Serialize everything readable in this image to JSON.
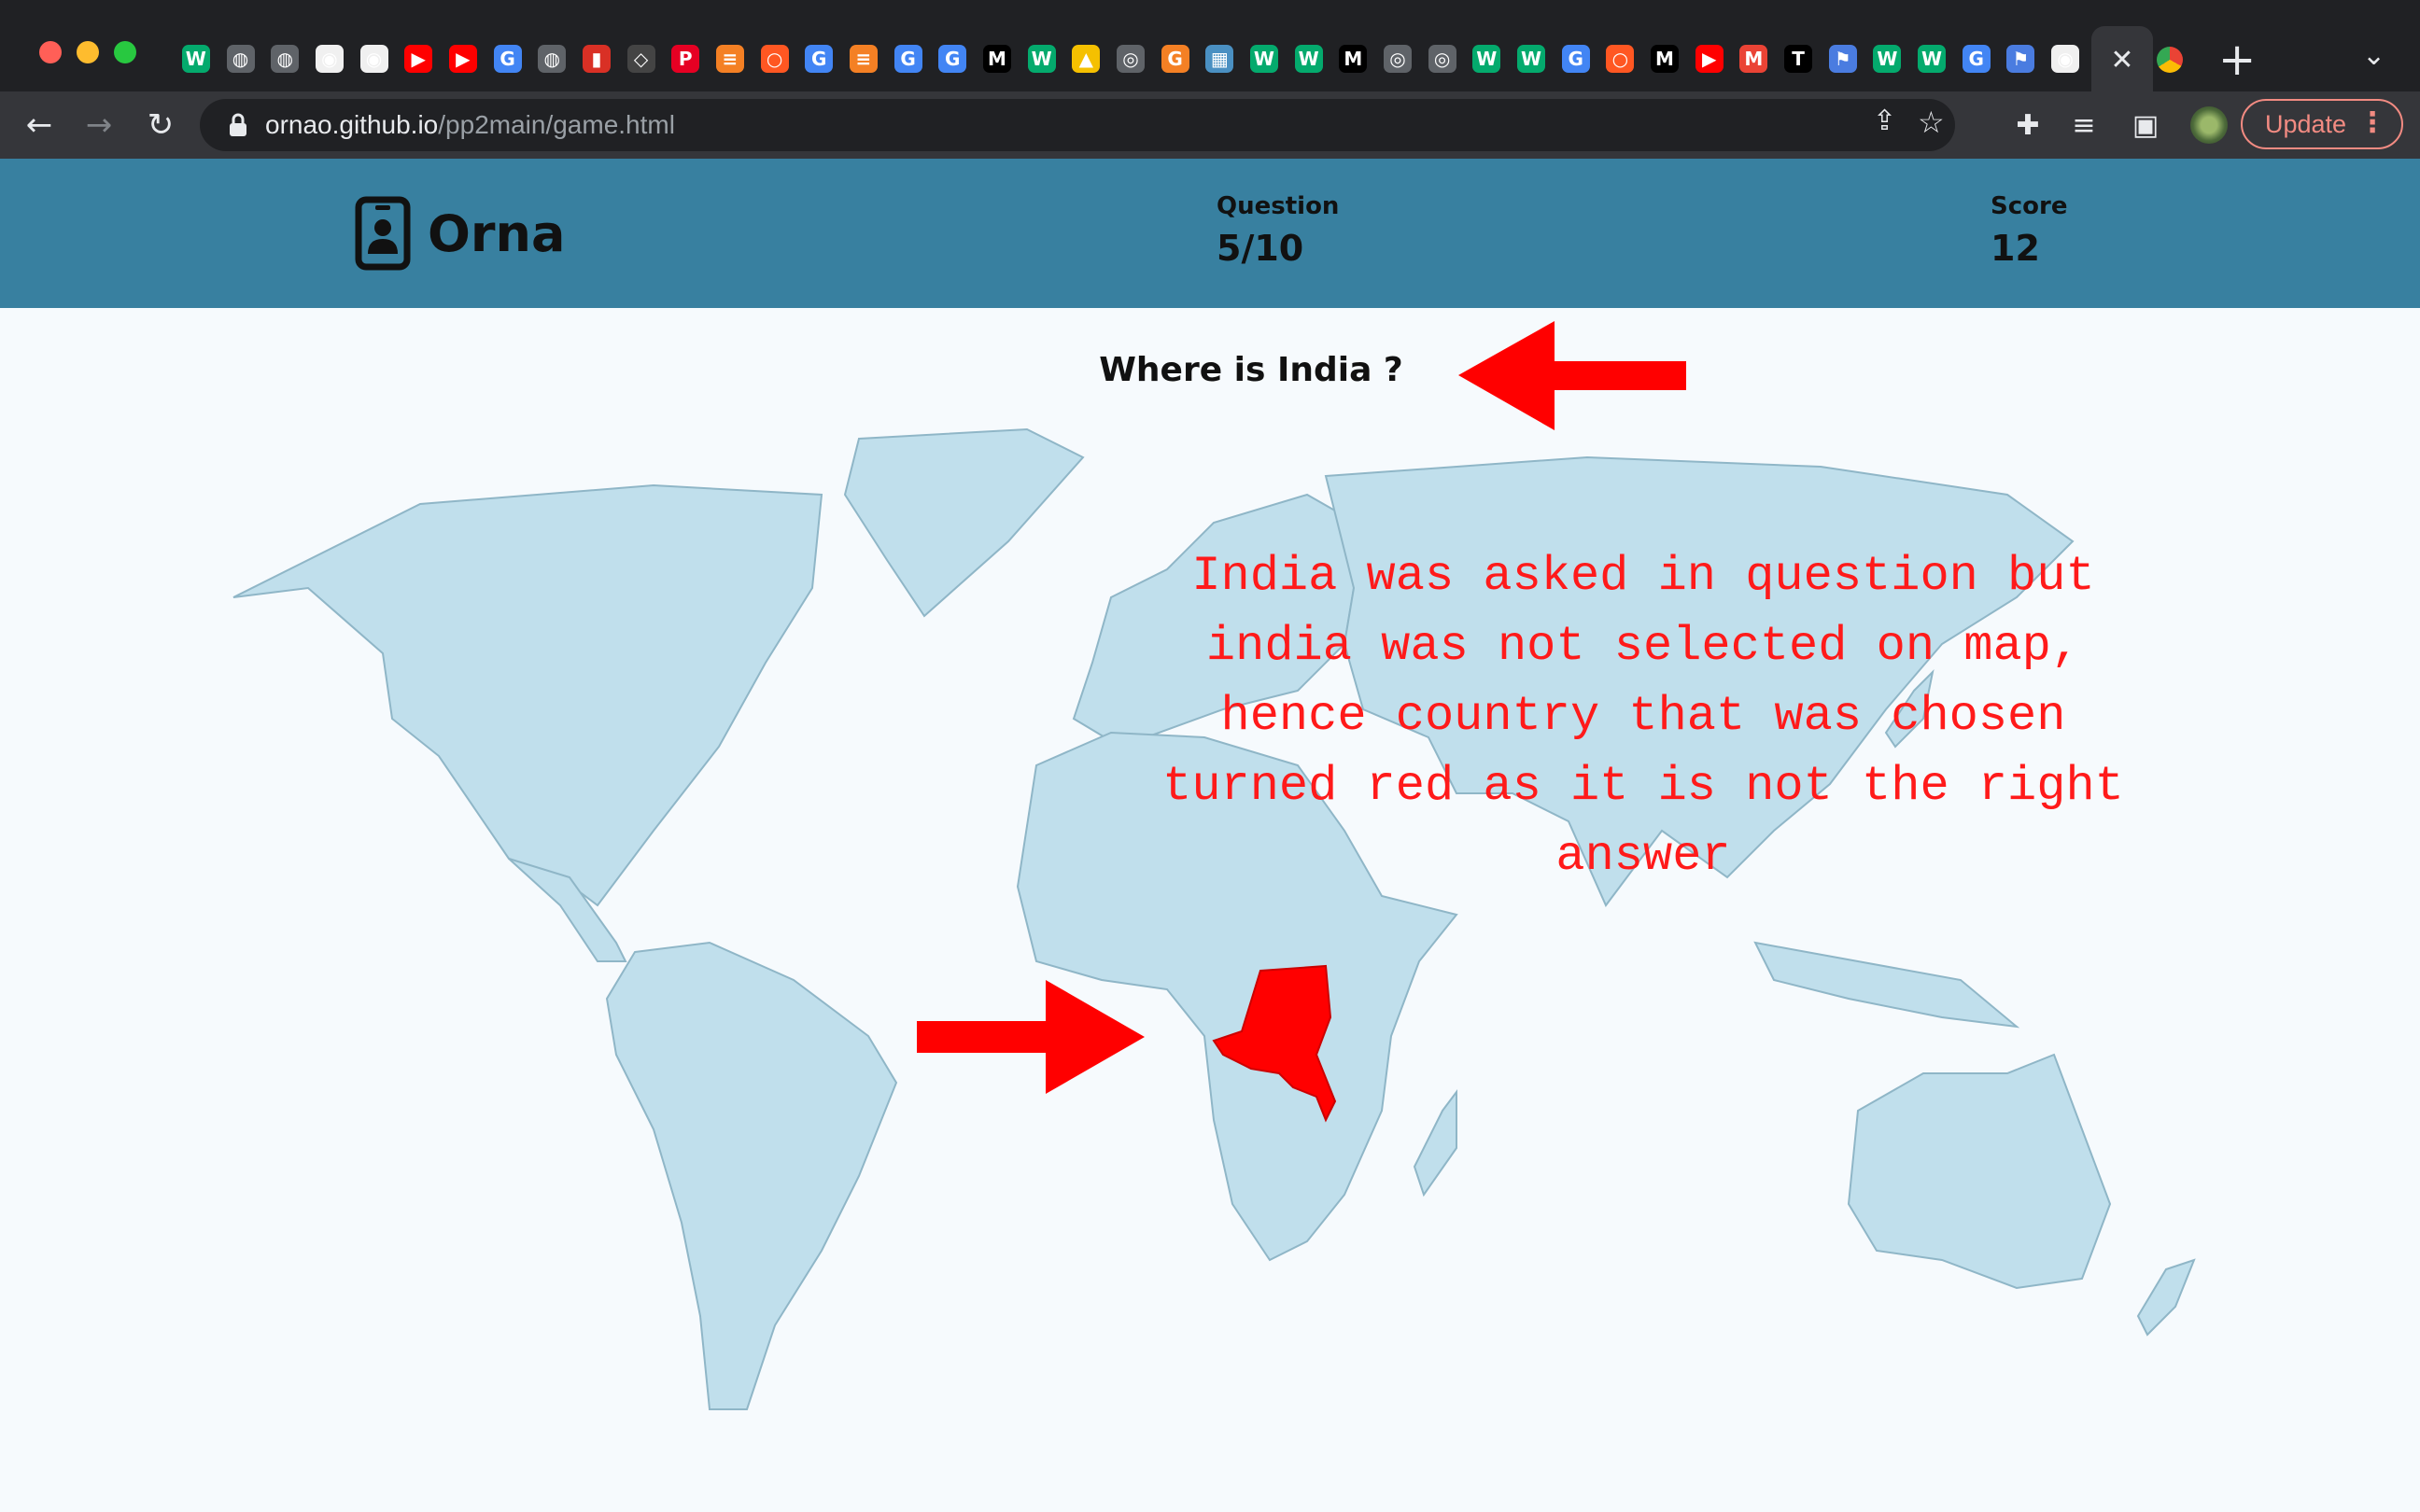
{
  "browser": {
    "tab_icons": [
      "w3schools-icon",
      "globe-icon",
      "globe-icon",
      "github-icon",
      "github-icon",
      "youtube-icon",
      "youtube-icon",
      "google-icon",
      "globe-icon",
      "lipstick-icon",
      "codepen-icon",
      "pinterest-icon",
      "stackoverflow-icon",
      "circle-icon",
      "google-icon",
      "stackoverflow-icon",
      "google-icon",
      "google-icon",
      "medium-icon",
      "w3schools-icon",
      "linux-icon",
      "chrome-icon",
      "g-icon",
      "map-icon",
      "w3schools-icon",
      "w3schools-icon",
      "medium-icon",
      "chrome-icon",
      "chrome-icon",
      "w3schools-icon",
      "w3schools-icon",
      "google-icon",
      "circle-icon",
      "medium-icon",
      "youtube-icon",
      "gmail-icon",
      "t-icon",
      "flag-icon",
      "w3schools-icon",
      "w3schools-icon",
      "google-icon",
      "flag-icon",
      "github-icon"
    ],
    "active_tab_close": "✕",
    "new_tab": "+",
    "url_domain": "ornao.github.io",
    "url_path": "/pp2main/game.html",
    "update_label": "Update",
    "colors": {
      "frame": "#202124",
      "toolbar": "#35363a",
      "update": "#f28b82"
    }
  },
  "header": {
    "brand": "Orna",
    "question_label": "Question",
    "question_value": "5/10",
    "score_label": "Score",
    "score_value": "12",
    "background": "#3880a0"
  },
  "game": {
    "prompt": "Where is India ?",
    "selected_country": "Democratic Republic of the Congo",
    "selected_color": "#ff0000",
    "land_color": "#c0dfec"
  },
  "annotation": {
    "text": "India was asked in question but india was not selected on map, hence country that was chosen turned red as it is not the right answer",
    "color": "#ff1a1a"
  }
}
